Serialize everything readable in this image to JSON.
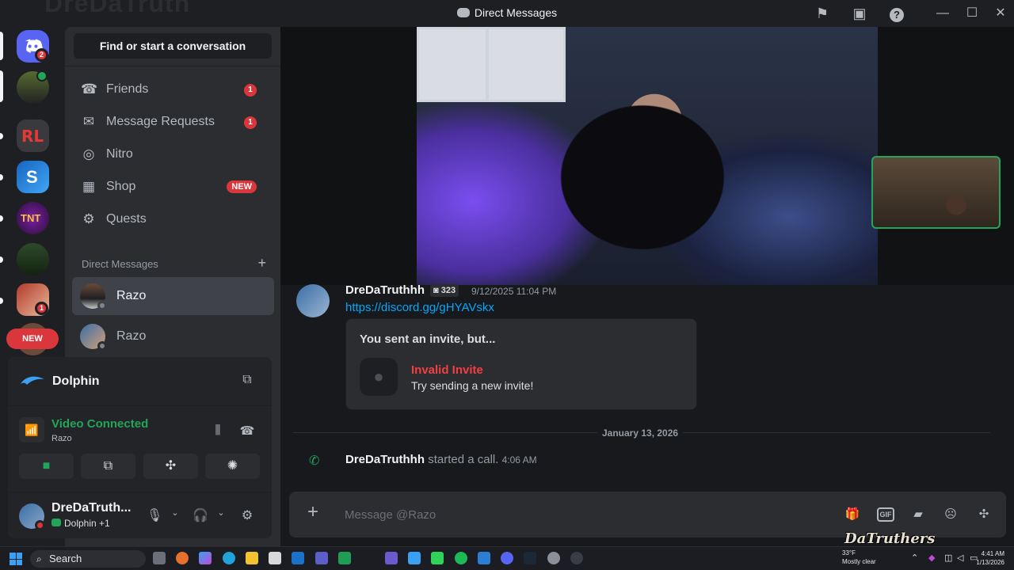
{
  "window": {
    "title": "Direct Messages",
    "ghost_title": "DreDaTruth"
  },
  "rail": {
    "home_badge": "2",
    "server_badge": "1",
    "new_pill": "NEW"
  },
  "sidebar": {
    "search_button": "Find or start a conversation",
    "nav": [
      {
        "label": "Friends",
        "badge": "1",
        "icon": "friends-icon"
      },
      {
        "label": "Message Requests",
        "badge": "1",
        "icon": "mail-icon"
      },
      {
        "label": "Nitro",
        "icon": "nitro-icon"
      },
      {
        "label": "Shop",
        "tag": "NEW",
        "icon": "shop-icon"
      },
      {
        "label": "Quests",
        "icon": "quests-icon"
      }
    ],
    "dm_header": "Direct Messages",
    "dms": [
      {
        "name": "Razo",
        "selected": true
      },
      {
        "name": "Razo",
        "selected": false
      }
    ]
  },
  "voice_panel": {
    "activity": "Dolphin",
    "status_title": "Video Connected",
    "status_sub": "Razo",
    "user": {
      "name": "DreDaTruth...",
      "sub": "Dolphin +1"
    }
  },
  "chat": {
    "message": {
      "author": "DreDaTruthhh",
      "tag": "323",
      "time": "9/12/2025 11:04 PM",
      "link": "https://discord.gg/gHYAVskx"
    },
    "invite": {
      "header": "You sent an invite, but...",
      "title": "Invalid Invite",
      "sub": "Try sending a new invite!"
    },
    "date_divider": "January 13, 2026",
    "call": {
      "author": "DreDaTruthhh",
      "text": "started a call.",
      "time": "4:06 AM"
    },
    "composer_placeholder": "Message @Razo"
  },
  "watermark": "DaTruthers",
  "taskbar": {
    "search": "Search",
    "temp": "33°F",
    "weather": "Mostly clear",
    "time": "4:41 AM",
    "date": "1/13/2026"
  },
  "colors": {
    "accent_blurple": "#5865f2",
    "green": "#23a559",
    "red": "#da373c",
    "link": "#00a8fc"
  }
}
